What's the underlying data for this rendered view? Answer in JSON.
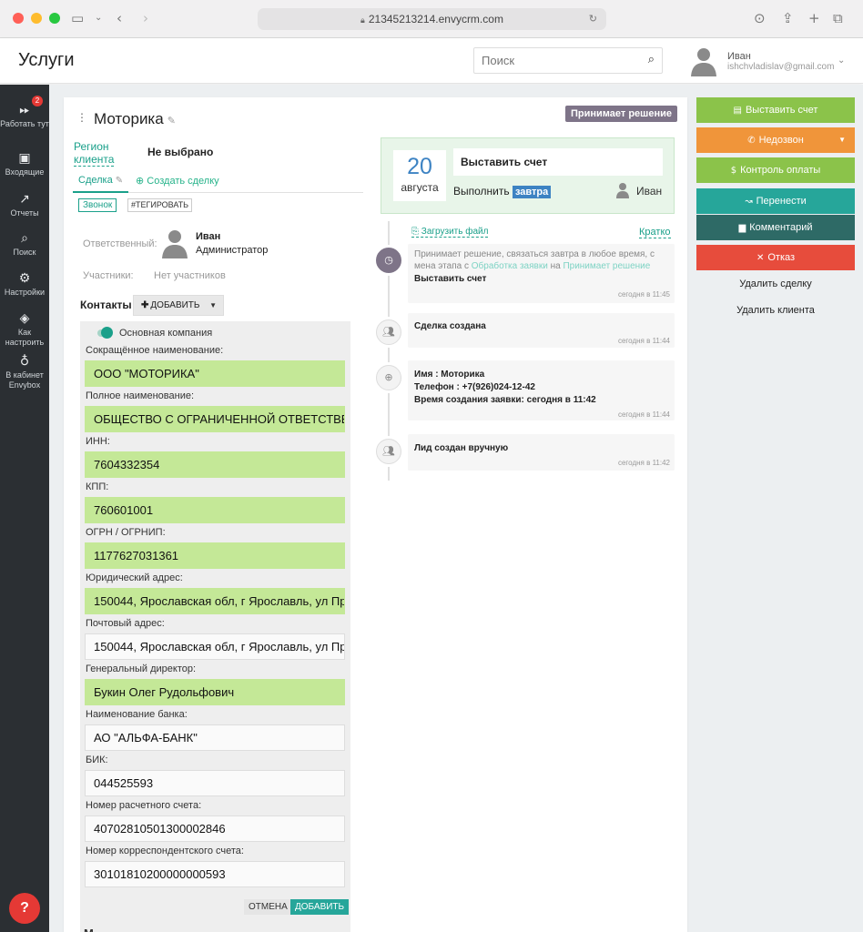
{
  "browser": {
    "url": "21345213214.envycrm.com",
    "traffic_colors": [
      "#ff5f57",
      "#febc2e",
      "#28c840"
    ]
  },
  "header": {
    "title": "Услуги",
    "search_placeholder": "Поиск",
    "user_name": "Иван",
    "user_email": "ishchvladislav@gmail.com"
  },
  "sidebar": {
    "items": [
      {
        "label": "Работать тут",
        "badge": "2",
        "icon": "fast-forward-icon"
      },
      {
        "label": "Входящие",
        "icon": "inbox-icon"
      },
      {
        "label": "Отчеты",
        "icon": "trend-icon"
      },
      {
        "label": "Поиск",
        "icon": "search-icon"
      },
      {
        "label": "Настройки",
        "icon": "gear-icon"
      },
      {
        "label": "Как настроить",
        "icon": "compass-icon"
      },
      {
        "label": "В кабинет Envybox",
        "icon": "bulb-icon"
      }
    ],
    "help": "?"
  },
  "deal": {
    "title": "Моторика",
    "stage": "Принимает решение",
    "region_label": "Регион клиента",
    "region_value": "Не выбрано",
    "tab_deal": "Сделка",
    "tab_create": "Создать сделку",
    "tags": [
      "Звонок",
      "#ТЕГИРОВАТЬ"
    ],
    "responsible_label": "Ответственный:",
    "responsible_name": "Иван",
    "responsible_role": "Администратор",
    "participants_label": "Участники:",
    "participants_value": "Нет участников",
    "contacts_label": "Контакты",
    "add_label": "ДОБАВИТЬ"
  },
  "company": {
    "main_company_label": "Основная компания",
    "fields": [
      {
        "label": "Сокращённое наименование:",
        "value": "ООО \"МОТОРИКА\"",
        "highlight": true
      },
      {
        "label": "Полное наименование:",
        "value": "ОБЩЕСТВО С ОГРАНИЧЕННОЙ ОТВЕТСТВЕННОСТЬЮ \"МОТОРИКА\"",
        "highlight": true
      },
      {
        "label": "ИНН:",
        "value": "7604332354",
        "highlight": true
      },
      {
        "label": "КПП:",
        "value": "760601001",
        "highlight": true
      },
      {
        "label": "ОГРН / ОГРНИП:",
        "value": "1177627031361",
        "highlight": true
      },
      {
        "label": "Юридический адрес:",
        "value": "150044, Ярославская обл, г Ярославль, ул Пр",
        "highlight": true
      },
      {
        "label": "Почтовый адрес:",
        "value": "150044, Ярославская обл, г Ярославль, ул Пр",
        "highlight": false
      },
      {
        "label": "Генеральный директор:",
        "value": "Букин Олег Рудольфович",
        "highlight": true
      },
      {
        "label": "Наименование банка:",
        "value": "АО \"АЛЬФА-БАНК\"",
        "highlight": false
      },
      {
        "label": "БИК:",
        "value": "044525593",
        "highlight": false
      },
      {
        "label": "Номер расчетного счета:",
        "value": "40702810501300002846",
        "highlight": false
      },
      {
        "label": "Номер корреспондентского счета:",
        "value": "30101810200000000593",
        "highlight": false
      }
    ],
    "cancel_label": "ОТМЕНА",
    "add_label": "ДОБАВИТЬ",
    "cut_text": "М"
  },
  "task": {
    "day": "20",
    "month": "августа",
    "title": "Выставить счет",
    "do_label": "Выполнить",
    "when": "завтра",
    "user": "Иван"
  },
  "timeline": {
    "upload_label": "Загрузить файл",
    "brief_label": "Кратко",
    "events": [
      {
        "icon": "clock-icon",
        "line1": "Принимает решение, связаться завтра в любое время, с",
        "line2_prefix": "мена этапа с ",
        "line2_from": "Обработка заявки",
        "line2_mid": " на ",
        "line2_to": "Принимает решение",
        "line3": "Выставить счет",
        "time": "сегодня в 11:45"
      },
      {
        "icon": "people-icon",
        "text": "Сделка создана",
        "time": "сегодня в 11:44"
      },
      {
        "icon": "add-person-icon",
        "line1": "Имя : Моторика",
        "line2": "Телефон : +7(926)024-12-42",
        "line3": "Время создания заявки: сегодня в 11:42",
        "time": "сегодня в 11:44"
      },
      {
        "icon": "people-icon",
        "text": "Лид создан вручную",
        "time": "сегодня в 11:42"
      }
    ]
  },
  "actions": {
    "buttons": [
      {
        "label": "Выставить счет",
        "color": "#8bc34a",
        "icon": "invoice-icon"
      },
      {
        "label": "Недозвон",
        "color": "#f0953a",
        "icon": "phone-icon"
      },
      {
        "label": "Контроль оплаты",
        "color": "#8bc34a",
        "icon": "dollar-icon"
      },
      {
        "label": "Перенести",
        "color": "#26a69a",
        "icon": "reschedule-icon"
      },
      {
        "label": "Комментарий",
        "color": "#2e6a66",
        "icon": "comment-icon"
      },
      {
        "label": "Отказ",
        "color": "#e74c3c",
        "icon": "close-icon"
      }
    ],
    "delete_deal": "Удалить сделку",
    "delete_client": "Удалить клиента"
  }
}
